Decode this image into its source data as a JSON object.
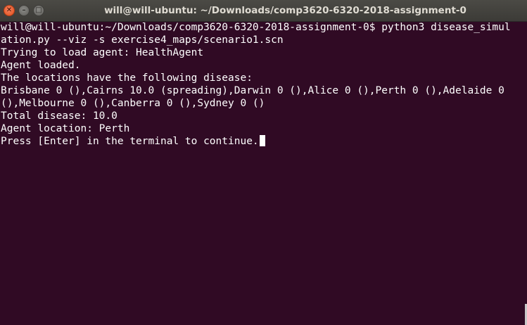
{
  "window": {
    "title": "will@will-ubuntu: ~/Downloads/comp3620-6320-2018-assignment-0",
    "close_glyph": "✕",
    "minimize_glyph": "–",
    "maximize_glyph": "□"
  },
  "terminal": {
    "lines": [
      "will@will-ubuntu:~/Downloads/comp3620-6320-2018-assignment-0$ python3 disease_simul",
      "ation.py --viz -s exercise4_maps/scenario1.scn",
      "Trying to load agent: HealthAgent",
      "Agent loaded.",
      "The locations have the following disease:",
      "Brisbane 0 (),Cairns 10.0 (spreading),Darwin 0 (),Alice 0 (),Perth 0 (),Adelaide 0",
      "(),Melbourne 0 (),Canberra 0 (),Sydney 0 ()",
      "Total disease: 10.0",
      "Agent location: Perth",
      "Press [Enter] in the terminal to continue."
    ]
  },
  "colors": {
    "background": "#300a24",
    "text": "#ffffff",
    "titlebar": "#3c3b37",
    "close_button": "#e95420"
  },
  "icons": [
    "close-icon",
    "minimize-icon",
    "maximize-icon"
  ]
}
